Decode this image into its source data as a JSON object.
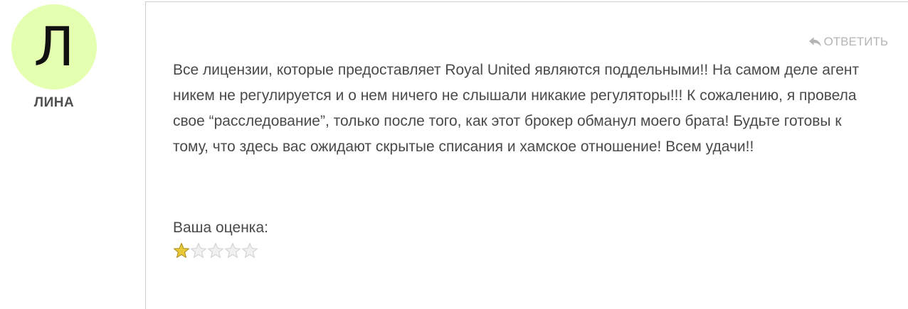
{
  "author": {
    "avatar_letter": "Л",
    "name": "ЛИНА",
    "avatar_color": "#e4ffaf"
  },
  "reply": {
    "label": "ОТВЕТИТЬ",
    "icon": "reply-arrow-icon"
  },
  "comment": {
    "text": "Все лицензии, которые предоставляет Royal United являются поддельными!! На самом деле агент никем не регулируется и о нем ничего не слышали никакие регуляторы!!! К сожалению, я провела свое “расследование”, только после того, как этот брокер обманул моего брата! Будьте готовы к тому, что здесь вас ожидают скрытые списания и хамское отношение! Всем удачи!!"
  },
  "rating": {
    "label": "Ваша оценка:",
    "value": 1,
    "max": 5,
    "filled_color": "#e8c93a",
    "empty_color": "#f0f0f0"
  }
}
